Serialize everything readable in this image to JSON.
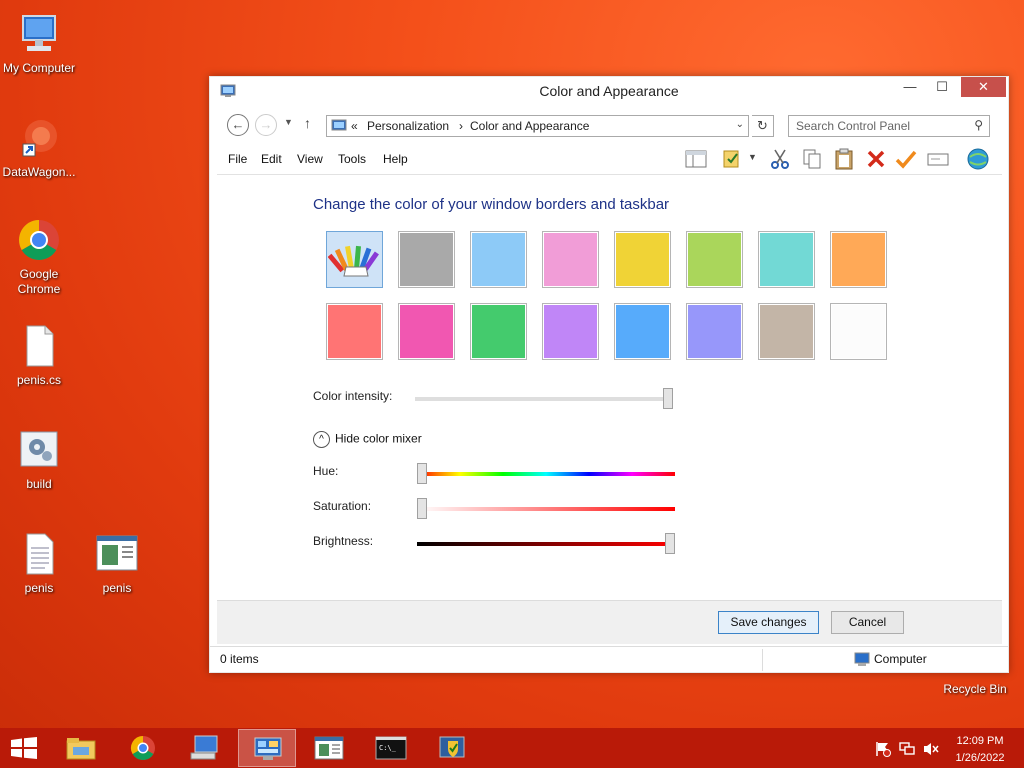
{
  "desktop": {
    "icons": [
      {
        "label": "My Computer"
      },
      {
        "label": "DataWagon..."
      },
      {
        "label": "Google Chrome"
      },
      {
        "label": "penis.cs"
      },
      {
        "label": "build"
      },
      {
        "label": "penis"
      },
      {
        "label": "penis"
      },
      {
        "label": "Recycle Bin"
      }
    ]
  },
  "window": {
    "title": "Color and Appearance",
    "controls": {
      "minimize": "—",
      "maximize": "☐",
      "close": "✕"
    },
    "address": {
      "prefix": "«",
      "crumbs": [
        "Personalization",
        "Color and Appearance"
      ],
      "separator": "›"
    },
    "search": {
      "placeholder": "Search Control Panel"
    },
    "menu": [
      "File",
      "Edit",
      "View",
      "Tools",
      "Help"
    ],
    "heading": "Change the color of your window borders and taskbar",
    "swatches_row1": [
      "auto",
      "#a9a9a9",
      "#8dcaf7",
      "#f19dd7",
      "#f0d336",
      "#aad65b",
      "#72d9d5",
      "#ffa957"
    ],
    "swatches_row2": [
      "#ff7474",
      "#f157b1",
      "#44cb6d",
      "#c086f7",
      "#57abfb",
      "#9797fa",
      "#c3b5a7",
      "#fcfcfc"
    ],
    "intensity_label": "Color intensity:",
    "intensity": 1.0,
    "mixer_toggle": "Hide color mixer",
    "hue_label": "Hue:",
    "hue": 0.0,
    "saturation_label": "Saturation:",
    "saturation": 0.0,
    "brightness_label": "Brightness:",
    "brightness": 1.0,
    "save_label": "Save changes",
    "cancel_label": "Cancel",
    "status_items": "0 items",
    "status_location": "Computer"
  },
  "taskbar": {
    "clock_time": "12:09 PM",
    "clock_date": "1/26/2022",
    "accent": "#b91a08"
  }
}
